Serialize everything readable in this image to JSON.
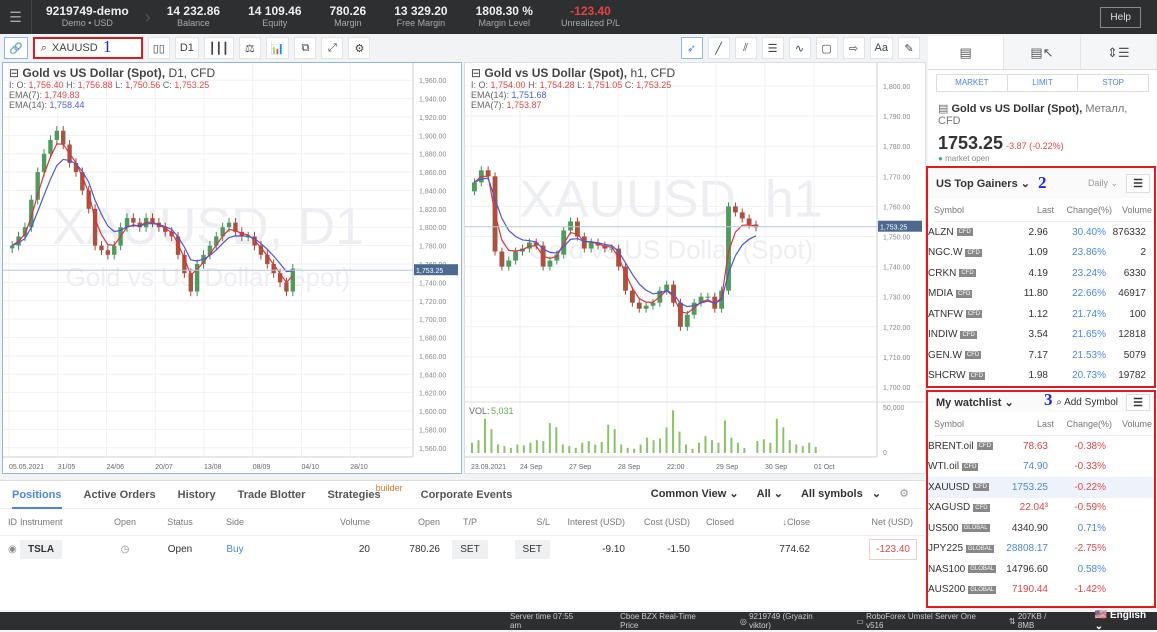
{
  "topbar": {
    "account_id": "9219749-demo",
    "account_type": "Demo • USD",
    "balance": "14 232.86",
    "balance_label": "Balance",
    "equity": "14 109.46",
    "equity_label": "Equity",
    "margin": "780.26",
    "margin_label": "Margin",
    "free_margin": "13 329.20",
    "free_margin_label": "Free Margin",
    "margin_level": "1808.30 %",
    "margin_level_label": "Margin Level",
    "unrealized": "-123.40",
    "unrealized_label": "Unrealized P/L",
    "help": "Help"
  },
  "toolbar": {
    "symbol": "XAUUSD",
    "timeframe": "D1",
    "annotation": "1",
    "right_text_tool": "Aa"
  },
  "chart_data": [
    {
      "type": "candlestick",
      "title": "Gold vs US Dollar (Spot),",
      "timeframe": "D1,",
      "kind": "CFD",
      "watermark1": "XAUUSD, D1",
      "watermark2": "Gold vs US Dollar (Spot)",
      "ohlc_label": "I: O:",
      "open": "1,756.40",
      "high_label": "H:",
      "high": "1,756.88",
      "low_label": "L:",
      "low": "1,750.56",
      "close_label": "C:",
      "close": "1,753.25",
      "ema7_label": "EMA(7):",
      "ema7": "1,749.83",
      "ema14_label": "EMA(14):",
      "ema14": "1,758.44",
      "ylim": [
        1550,
        1970
      ],
      "yticks": [
        "1,960.00",
        "1,940.00",
        "1,920.00",
        "1,900.00",
        "1,880.00",
        "1,860.00",
        "1,840.00",
        "1,820.00",
        "1,800.00",
        "1,780.00",
        "1,760.00",
        "1,740.00",
        "1,720.00",
        "1,700.00",
        "1,680.00",
        "1,660.00",
        "1,640.00",
        "1,620.00",
        "1,600.00",
        "1,580.00",
        "1,560.00"
      ],
      "xticks": [
        "05.05.2021",
        "31/05",
        "24/06",
        "20/07",
        "13/08",
        "08/09",
        "04/10",
        "28/10"
      ],
      "last_price": "1,753.25",
      "close_series": [
        1780,
        1790,
        1800,
        1830,
        1860,
        1880,
        1895,
        1905,
        1890,
        1870,
        1860,
        1840,
        1820,
        1780,
        1775,
        1770,
        1780,
        1800,
        1810,
        1805,
        1800,
        1810,
        1805,
        1800,
        1795,
        1790,
        1770,
        1750,
        1730,
        1760,
        1770,
        1780,
        1790,
        1800,
        1805,
        1795,
        1790,
        1790,
        1780,
        1770,
        1760,
        1750,
        1740,
        1730,
        1755
      ]
    },
    {
      "type": "candlestick",
      "title": "Gold vs US Dollar (Spot),",
      "timeframe": "h1,",
      "kind": "CFD",
      "watermark1": "XAUUSD, h1",
      "watermark2": "Gold vs US Dollar (Spot)",
      "ohlc_label": "I: O:",
      "open": "1,754.00",
      "high_label": "H:",
      "high": "1,754.28",
      "low_label": "L:",
      "low": "1,751.05",
      "close_label": "C:",
      "close": "1,753.25",
      "ema14_label": "EMA(14):",
      "ema14": "1,751.68",
      "ema7_label": "EMA(7):",
      "ema7": "1,753.87",
      "ylim": [
        1695,
        1805
      ],
      "yticks": [
        "1,800.00",
        "1,790.00",
        "1,780.00",
        "1,770.00",
        "1,760.00",
        "1,750.00",
        "1,740.00",
        "1,730.00",
        "1,720.00",
        "1,710.00",
        "1,700.00"
      ],
      "xticks": [
        "23.09.2021",
        "24 Sep",
        "27 Sep",
        "28 Sep",
        "22:00",
        "29 Sep",
        "30 Sep",
        "01 Oct"
      ],
      "last_price": "1,753.25",
      "close_series": [
        1768,
        1772,
        1770,
        1745,
        1740,
        1742,
        1745,
        1746,
        1748,
        1747,
        1740,
        1742,
        1744,
        1752,
        1755,
        1750,
        1746,
        1748,
        1747,
        1746,
        1746,
        1740,
        1732,
        1728,
        1726,
        1727,
        1728,
        1732,
        1734,
        1728,
        1720,
        1724,
        1728,
        1730,
        1730,
        1726,
        1732,
        1760,
        1758,
        1756,
        1754,
        1753
      ],
      "volume_label": "VOL:",
      "volume": "5,031",
      "volume_yticks": [
        "50,000",
        "0"
      ],
      "volume_series": [
        12,
        15,
        40,
        28,
        10,
        8,
        6,
        10,
        9,
        12,
        15,
        14,
        35,
        30,
        10,
        8,
        6,
        12,
        14,
        10,
        13,
        33,
        28,
        10,
        6,
        5,
        10,
        18,
        15,
        17,
        30,
        50,
        25,
        10,
        5,
        12,
        20,
        15,
        12,
        38,
        18,
        12,
        6,
        0,
        14,
        16,
        12,
        40,
        30,
        15,
        10,
        8,
        12,
        7
      ]
    }
  ],
  "bottom": {
    "tabs": [
      "Positions",
      "Active Orders",
      "History",
      "Trade Blotter",
      "Strategies",
      "Corporate Events"
    ],
    "strategies_sup": "builder",
    "filters": {
      "view": "Common View",
      "all": "All",
      "symbols": "All symbols"
    },
    "columns": [
      "ID",
      "Instrument",
      "Open",
      "Status",
      "Side",
      "Volume",
      "Open",
      "T/P",
      "S/L",
      "Interest (USD)",
      "Cost (USD)",
      "Closed",
      "↓Close",
      "Net (USD)"
    ],
    "rows": [
      {
        "instrument": "TSLA",
        "status": "Open",
        "side": "Buy",
        "volume": "20",
        "open": "780.26",
        "tp": "SET",
        "sl": "SET",
        "interest": "-9.10",
        "cost": "-1.50",
        "closed": "",
        "close": "774.62",
        "net": "-123.40"
      }
    ]
  },
  "order": {
    "types": [
      "MARKET",
      "LIMIT",
      "STOP"
    ],
    "instrument": "Gold vs US Dollar (Spot),",
    "category": "Металл, CFD",
    "price": "1753.25",
    "change": "-3.87 (-0.22%)",
    "status": "market open"
  },
  "gainers": {
    "title": "US Top Gainers",
    "annotation": "2",
    "period": "Daily",
    "columns": [
      "Symbol",
      "Last",
      "Change(%)",
      "Volume"
    ],
    "rows": [
      {
        "s": "ALZN",
        "b": "CFD",
        "l": "2.96",
        "c": "30.40%",
        "v": "876332"
      },
      {
        "s": "NGC.W",
        "b": "CFD",
        "l": "1.09",
        "c": "23.86%",
        "v": "2"
      },
      {
        "s": "CRKN",
        "b": "CFD",
        "l": "4.19",
        "c": "23.24%",
        "v": "6330"
      },
      {
        "s": "MDIA",
        "b": "CFD",
        "l": "11.80",
        "c": "22.66%",
        "v": "46917"
      },
      {
        "s": "ATNFW",
        "b": "CFD",
        "l": "1.12",
        "c": "21.74%",
        "v": "100"
      },
      {
        "s": "INDIW",
        "b": "CFD",
        "l": "3.54",
        "c": "21.65%",
        "v": "12818"
      },
      {
        "s": "GEN.W",
        "b": "CFD",
        "l": "7.17",
        "c": "21.53%",
        "v": "5079"
      },
      {
        "s": "SHCRW",
        "b": "CFD",
        "l": "1.98",
        "c": "20.73%",
        "v": "19782"
      }
    ]
  },
  "watchlist": {
    "title": "My watchlist",
    "annotation": "3",
    "add_symbol": "Add Symbol",
    "columns": [
      "Symbol",
      "Last",
      "Change(%)",
      "Volume"
    ],
    "rows": [
      {
        "s": "BRENT.oil",
        "b": "CFD",
        "l": "78.63",
        "lc": "#e04545",
        "c": "-0.38%",
        "cc": "#e04545"
      },
      {
        "s": "WTI.oil",
        "b": "CFD",
        "l": "74.90",
        "lc": "#4a86e8",
        "c": "-0.33%",
        "cc": "#e04545"
      },
      {
        "s": "XAUUSD",
        "b": "CFD",
        "l": "1753.25",
        "lc": "#4a86e8",
        "c": "-0.22%",
        "cc": "#e04545"
      },
      {
        "s": "XAGUSD",
        "b": "CFD",
        "l": "22.04³",
        "lc": "#e04545",
        "c": "-0.59%",
        "cc": "#e04545"
      },
      {
        "s": "US500",
        "b": "GLOBAL",
        "l": "4340.90",
        "lc": "#333",
        "c": "0.71%",
        "cc": "#4a86e8"
      },
      {
        "s": "JPY225",
        "b": "GLOBAL",
        "l": "28808.17",
        "lc": "#4a86e8",
        "c": "-2.75%",
        "cc": "#e04545"
      },
      {
        "s": "NAS100",
        "b": "GLOBAL",
        "l": "14796.60",
        "lc": "#333",
        "c": "0.58%",
        "cc": "#4a86e8"
      },
      {
        "s": "AUS200",
        "b": "GLOBAL",
        "l": "7190.44",
        "lc": "#e04545",
        "c": "-1.42%",
        "cc": "#e04545"
      }
    ]
  },
  "statusbar": {
    "server_time": "Server time 07:55 am",
    "feed": "Cboe BZX Real-Time Price",
    "user": "9219749 (Gryazin viktor)",
    "server": "RoboForex Umstel Server One v516",
    "traffic": "207KB / 8MB",
    "language": "English"
  }
}
